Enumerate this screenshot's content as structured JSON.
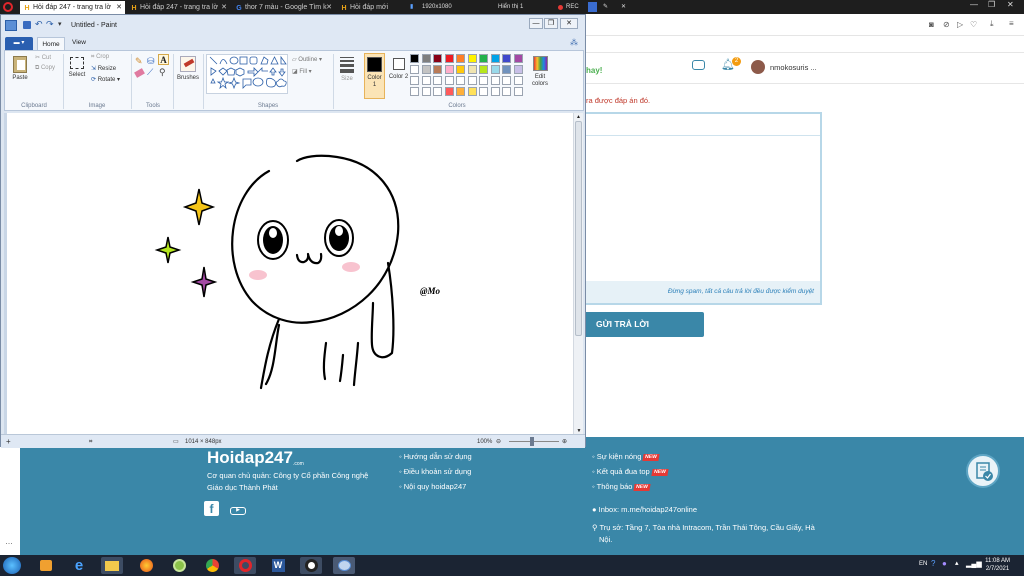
{
  "opera": {
    "tabs": [
      {
        "label": "Hỏi đáp 247 - trang tra lờ",
        "active": true
      },
      {
        "label": "Hỏi đáp 247 - trang tra lờ",
        "active": false
      },
      {
        "label": "thor 7 màu - Google Tìm k",
        "active": false
      },
      {
        "label": "Hỏi đáp mới",
        "active": false
      }
    ],
    "resolution": "1920x1080",
    "display": "Hiển thị 1",
    "rec": "REC"
  },
  "site": {
    "hay_text": "hay!",
    "notification_count": "2",
    "username": "nmokosuris ...",
    "notice": "ra được đáp án đó.",
    "spam_notice": "Đừng spam, tất cả câu trả lời đều được kiểm duyệt",
    "submit_label": "GỬI TRẢ LỜI"
  },
  "footer": {
    "logo": "Hoidap247",
    "logo_sub": ".com",
    "org_line1": "Cơ quan chủ quản: Công ty Cổ phần Công nghệ",
    "org_line2": "Giáo dục Thành Phát",
    "links_col1": [
      "Hướng dẫn sử dụng",
      "Điều khoản sử dụng",
      "Nội quy hoidap247"
    ],
    "links_col2": [
      "Sự kiện nóng",
      "Kết quả đua top",
      "Thông báo"
    ],
    "new_badge": "NEW",
    "inbox": "Inbox: m.me/hoidap247online",
    "address_line1": "Trụ sở: Tầng 7, Tòa nhà Intracom, Trần Thái Tông, Cầu Giấy, Hà",
    "address_line2": "Nội."
  },
  "paint": {
    "title": "Untitled - Paint",
    "tabs": [
      "Home",
      "View"
    ],
    "groups": {
      "clipboard": "Clipboard",
      "image": "Image",
      "tools": "Tools",
      "shapes": "Shapes",
      "colors": "Colors"
    },
    "buttons": {
      "paste": "Paste",
      "cut": "Cut",
      "copy": "Copy",
      "select": "Select",
      "crop": "Crop",
      "resize": "Resize",
      "rotate": "Rotate",
      "brushes": "Brushes",
      "outline": "Outline",
      "fill": "Fill",
      "size": "Size",
      "color1": "Color 1",
      "color2": "Color 2",
      "edit_colors": "Edit colors"
    },
    "palette": [
      "#000000",
      "#7f7f7f",
      "#880015",
      "#ed1c24",
      "#ff7f27",
      "#fff200",
      "#22b14c",
      "#00a2e8",
      "#3f48cc",
      "#a349a4",
      "#ffffff",
      "#c3c3c3",
      "#b97a57",
      "#ffaec9",
      "#ffc90e",
      "#efe4b0",
      "#b5e61d",
      "#99d9ea",
      "#7092be",
      "#c8bfe7",
      "#ffffff",
      "#ffffff",
      "#ffffff",
      "#ffffff",
      "#ffffff",
      "#ffffff",
      "#ffffff",
      "#ffffff",
      "#ffffff",
      "#ffffff",
      "#ffffff",
      "#ffffff",
      "#ffffff",
      "#ff5a5a",
      "#ffb03a",
      "#ffe15a",
      "#ffffff",
      "#ffffff",
      "#ffffff",
      "#ffffff"
    ],
    "color1": "#000000",
    "color2": "#ffffff",
    "signature": "@Mo",
    "status_size": "1014 × 848px",
    "zoom": "100%"
  },
  "taskbar": {
    "time": "11:08 AM",
    "date": "2/7/2021",
    "lang": "EN"
  }
}
